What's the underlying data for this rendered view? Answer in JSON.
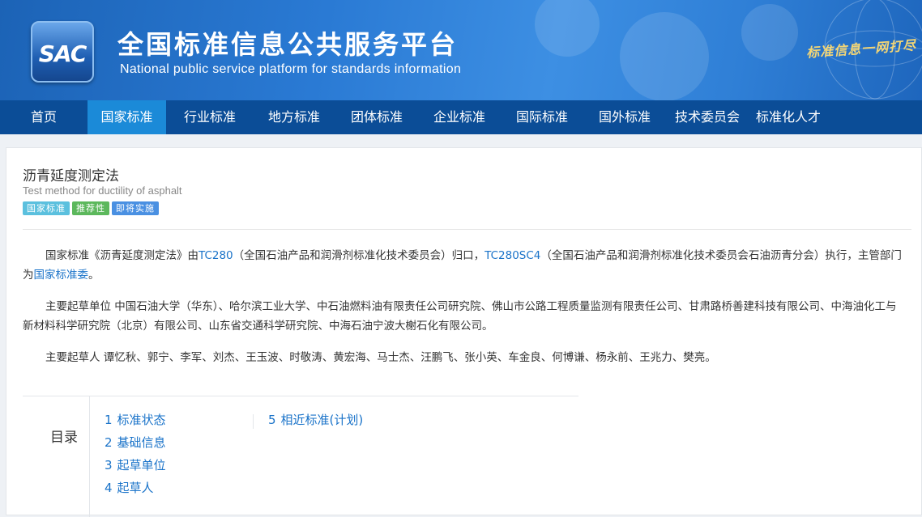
{
  "header": {
    "logo_text": "SAC",
    "title": "全国标准信息公共服务平台",
    "subtitle": "National public service platform  for standards information",
    "slogan": "标准信息一网打尽"
  },
  "nav": {
    "items": [
      {
        "label": "首页",
        "active": false
      },
      {
        "label": "国家标准",
        "active": true
      },
      {
        "label": "行业标准",
        "active": false
      },
      {
        "label": "地方标准",
        "active": false
      },
      {
        "label": "团体标准",
        "active": false
      },
      {
        "label": "企业标准",
        "active": false
      },
      {
        "label": "国际标准",
        "active": false
      },
      {
        "label": "国外标准",
        "active": false
      },
      {
        "label": "技术委员会",
        "active": false
      },
      {
        "label": "标准化人才",
        "active": false
      }
    ]
  },
  "standard": {
    "title": "沥青延度测定法",
    "english_title": "Test method for ductility of asphalt",
    "tags": [
      "国家标准",
      "推荐性",
      "即将实施"
    ]
  },
  "description": {
    "p1_prefix": "国家标准《沥青延度测定法》由",
    "p1_tc": "TC280",
    "p1_tc_desc": "（全国石油产品和润滑剂标准化技术委员会）归口，",
    "p1_sc": "TC280SC4",
    "p1_sc_desc": "（全国石油产品和润滑剂标准化技术委员会石油沥青分会）执行，主管部门为",
    "p1_dept": "国家标准委",
    "p1_end": "。",
    "p2": "主要起草单位 中国石油大学（华东）、哈尔滨工业大学、中石油燃料油有限责任公司研究院、佛山市公路工程质量监测有限责任公司、甘肃路桥善建科技有限公司、中海油化工与新材料科学研究院（北京）有限公司、山东省交通科学研究院、中海石油宁波大榭石化有限公司。",
    "p3": "主要起草人 谭忆秋、郭宁、李军、刘杰、王玉波、时敬涛、黄宏海、马士杰、汪鹏飞、张小英、车金良、何博谦、杨永前、王兆力、樊亮。"
  },
  "toc": {
    "label": "目录",
    "left": [
      {
        "num": "1",
        "label": "标准状态"
      },
      {
        "num": "2",
        "label": "基础信息"
      },
      {
        "num": "3",
        "label": "起草单位"
      },
      {
        "num": "4",
        "label": "起草人"
      }
    ],
    "right": [
      {
        "num": "5",
        "label": "相近标准(计划)"
      }
    ]
  },
  "colors": {
    "header_blue": "#2a7ad4",
    "nav_bg": "#0b4d97",
    "nav_active": "#1b8ad8",
    "link": "#1a73c9",
    "tag_national": "#5bc0de",
    "tag_recommended": "#5cb85c",
    "tag_upcoming": "#4a90e2"
  }
}
